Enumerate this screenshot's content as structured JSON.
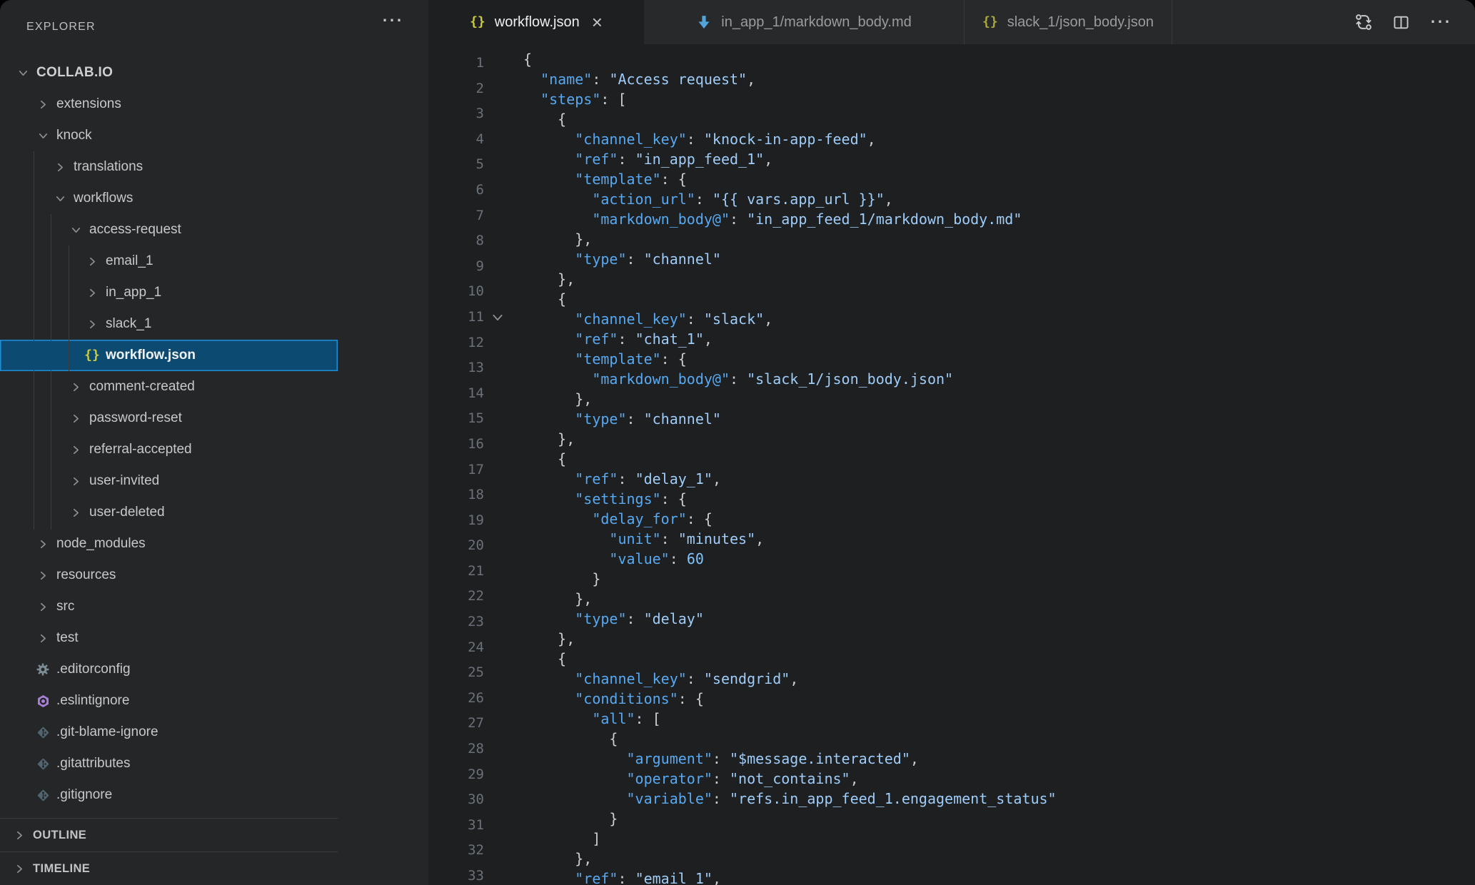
{
  "sidebar": {
    "header": {
      "title": "EXPLORER",
      "more_label": "⋯"
    },
    "tree": [
      {
        "label": "COLLAB.IO",
        "depth": 0,
        "marker": "expanded",
        "root": true
      },
      {
        "label": "extensions",
        "depth": 1,
        "marker": "collapsed"
      },
      {
        "label": "knock",
        "depth": 1,
        "marker": "expanded"
      },
      {
        "label": "translations",
        "depth": 2,
        "marker": "collapsed"
      },
      {
        "label": "workflows",
        "depth": 2,
        "marker": "expanded"
      },
      {
        "label": "access-request",
        "depth": 3,
        "marker": "expanded"
      },
      {
        "label": "email_1",
        "depth": 4,
        "marker": "collapsed"
      },
      {
        "label": "in_app_1",
        "depth": 4,
        "marker": "collapsed"
      },
      {
        "label": "slack_1",
        "depth": 4,
        "marker": "collapsed"
      },
      {
        "label": "workflow.json",
        "depth": 4,
        "icon": "json",
        "selected": true
      },
      {
        "label": "comment-created",
        "depth": 3,
        "marker": "collapsed"
      },
      {
        "label": "password-reset",
        "depth": 3,
        "marker": "collapsed"
      },
      {
        "label": "referral-accepted",
        "depth": 3,
        "marker": "collapsed"
      },
      {
        "label": "user-invited",
        "depth": 3,
        "marker": "collapsed"
      },
      {
        "label": "user-deleted",
        "depth": 3,
        "marker": "collapsed"
      },
      {
        "label": "node_modules",
        "depth": 1,
        "marker": "collapsed"
      },
      {
        "label": "resources",
        "depth": 1,
        "marker": "collapsed"
      },
      {
        "label": "src",
        "depth": 1,
        "marker": "collapsed"
      },
      {
        "label": "test",
        "depth": 1,
        "marker": "collapsed"
      },
      {
        "label": ".editorconfig",
        "depth": 1,
        "icon": "gear"
      },
      {
        "label": ".eslintignore",
        "depth": 1,
        "icon": "eslint"
      },
      {
        "label": ".git-blame-ignore",
        "depth": 1,
        "icon": "git"
      },
      {
        "label": ".gitattributes",
        "depth": 1,
        "icon": "git"
      },
      {
        "label": ".gitignore",
        "depth": 1,
        "icon": "git"
      }
    ],
    "panels": [
      {
        "label": "OUTLINE"
      },
      {
        "label": "TIMELINE"
      }
    ]
  },
  "tabs": {
    "items": [
      {
        "label": "workflow.json",
        "icon": "json",
        "active": true,
        "close_label": "×"
      },
      {
        "label": "in_app_1/markdown_body.md",
        "icon": "markdown",
        "active": false
      },
      {
        "label": "slack_1/json_body.json",
        "icon": "json",
        "active": false
      }
    ],
    "actions": [
      {
        "name": "open-changes"
      },
      {
        "name": "split-editor"
      },
      {
        "name": "more-actions",
        "label": "⋯"
      }
    ]
  },
  "editor": {
    "gutter": {
      "first_line": 1,
      "last_line": 33,
      "fold_marker_line": 11
    },
    "code_lines": [
      "{",
      "  \"name\": \"Access request\",",
      "  \"steps\": [",
      "    {",
      "      \"channel_key\": \"knock-in-app-feed\",",
      "      \"ref\": \"in_app_feed_1\",",
      "      \"template\": {",
      "        \"action_url\": \"{{ vars.app_url }}\",",
      "        \"markdown_body@\": \"in_app_feed_1/markdown_body.md\"",
      "      },",
      "      \"type\": \"channel\"",
      "    },",
      "    {",
      "      \"channel_key\": \"slack\",",
      "      \"ref\": \"chat_1\",",
      "      \"template\": {",
      "        \"markdown_body@\": \"slack_1/json_body.json\"",
      "      },",
      "      \"type\": \"channel\"",
      "    },",
      "    {",
      "      \"ref\": \"delay_1\",",
      "      \"settings\": {",
      "        \"delay_for\": {",
      "          \"unit\": \"minutes\",",
      "          \"value\": 60",
      "        }",
      "      },",
      "      \"type\": \"delay\"",
      "    },",
      "    {",
      "      \"channel_key\": \"sendgrid\",",
      "      \"conditions\": {",
      "        \"all\": [",
      "          {",
      "            \"argument\": \"$message.interacted\",",
      "            \"operator\": \"not_contains\",",
      "            \"variable\": \"refs.in_app_feed_1.engagement_status\"",
      "          }",
      "        ]",
      "      },",
      "      \"ref\": \"email_1\","
    ]
  },
  "colors": {
    "editor_background": "#1d1f20",
    "sidebar_background": "#242628",
    "tabbar_background": "#28292b",
    "selection_fill": "#0c4a72",
    "selection_border": "#1e8fd5",
    "json_key": "#58a9f2",
    "json_string": "#9fccf8",
    "json_number": "#82c3ff",
    "json_icon_yellow": "#cbcb41",
    "markdown_icon_blue": "#52a3d8",
    "eslint_icon_purple": "#a87fd6",
    "gear_icon_slate": "#7b8c95",
    "git_icon_slate": "#50656f"
  }
}
